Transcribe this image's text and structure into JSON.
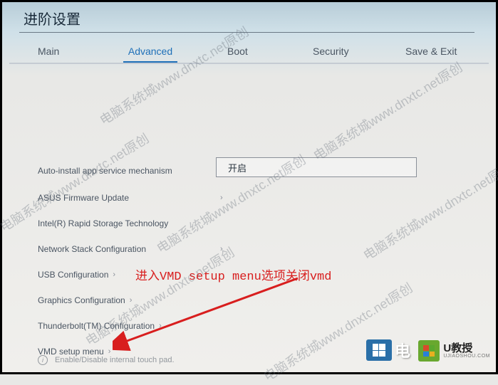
{
  "header": {
    "title": "进阶设置"
  },
  "tabs": [
    "Main",
    "Advanced",
    "Boot",
    "Security",
    "Save & Exit"
  ],
  "active_tab": 1,
  "items": [
    {
      "label": "Auto-install app service mechanism",
      "value": "开启"
    },
    {
      "label": "ASUS Firmware Update"
    },
    {
      "label": "Intel(R) Rapid Storage Technology"
    },
    {
      "label": "Network Stack Configuration"
    },
    {
      "label": "USB Configuration"
    },
    {
      "label": "Graphics Configuration"
    },
    {
      "label": "Thunderbolt(TM) Configuration"
    },
    {
      "label": "VMD setup menu"
    }
  ],
  "help_text": "Enable/Disable internal touch pad.",
  "annotation": {
    "text": "进入VMD setup menu选项关闭vmd"
  },
  "watermark": "电脑系统城www.dnxtc.net原创",
  "logos": [
    {
      "text": "电"
    },
    {
      "text1": "U教授",
      "text2": "UJIAOSHOU.COM"
    }
  ]
}
